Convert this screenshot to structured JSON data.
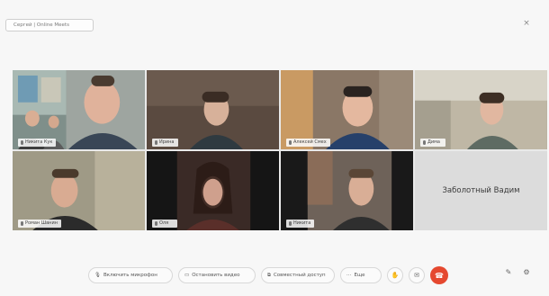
{
  "bookmarks": [
    "",
    "",
    "",
    "",
    "",
    "",
    "",
    ""
  ],
  "meeting": {
    "pill_accent": "",
    "pill_text": "Сергей | Online Meets"
  },
  "participants": [
    {
      "name": "Никита Кук",
      "active": true
    },
    {
      "name": "Ирина",
      "active": false
    },
    {
      "name": "Алексей Смех",
      "active": false
    },
    {
      "name": "Дима",
      "active": false
    },
    {
      "name": "Роман Шанин",
      "active": false
    },
    {
      "name": "Оля",
      "active": false
    },
    {
      "name": "Никита",
      "active": false
    },
    {
      "name": "Заболотный Вадим",
      "active": false,
      "placeholder": true
    }
  ],
  "toolbar": {
    "btn_mic": "Включить микрофон",
    "btn_camera": "Остановить видео",
    "btn_share": "Совместный доступ",
    "btn_more": "Еще"
  },
  "colors": {
    "accent": "#3fa6d6",
    "end_call": "#e5482f"
  },
  "icons": [
    "mic-icon",
    "camera-icon",
    "screen-share-icon",
    "more-icon",
    "hand-icon",
    "chat-icon",
    "end-call-icon",
    "pencil-icon",
    "settings-icon",
    "close-icon"
  ]
}
